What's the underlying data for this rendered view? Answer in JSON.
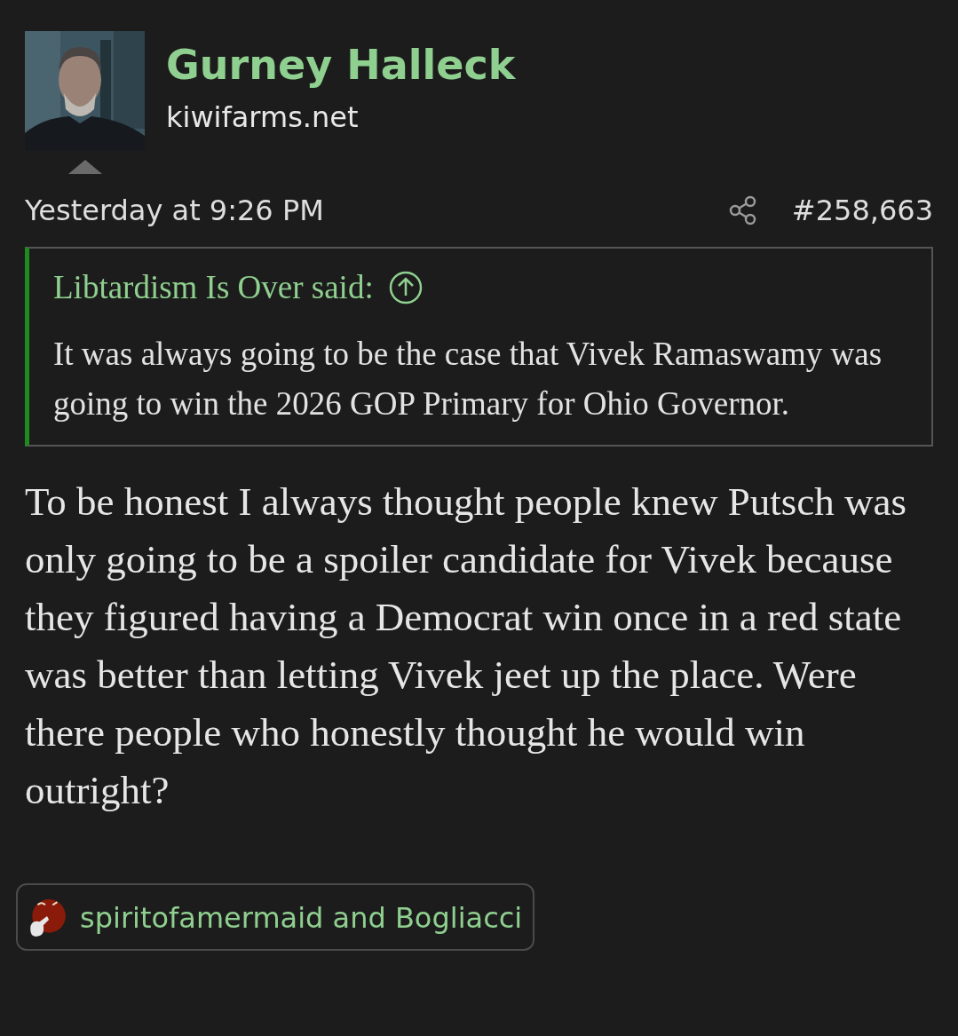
{
  "post": {
    "author": "Gurney Halleck",
    "site": "kiwifarms.net",
    "timestamp": "Yesterday at 9:26 PM",
    "number": "#258,663",
    "quote": {
      "attribution": "Libtardism Is Over said:",
      "text": "It was always going to be the case that Vivek Ramaswamy was going to win the 2026 GOP Primary for Ohio Governor."
    },
    "body": "To be honest I always thought people knew Putsch was only going to be a spoiler candidate for Vivek because they figured having a Democrat win once in a red state was better than letting Vivek jeet up the place. Were there people who honestly thought he would win outright?",
    "reactions": {
      "users": "spiritofamermaid and Bogliacci"
    }
  }
}
